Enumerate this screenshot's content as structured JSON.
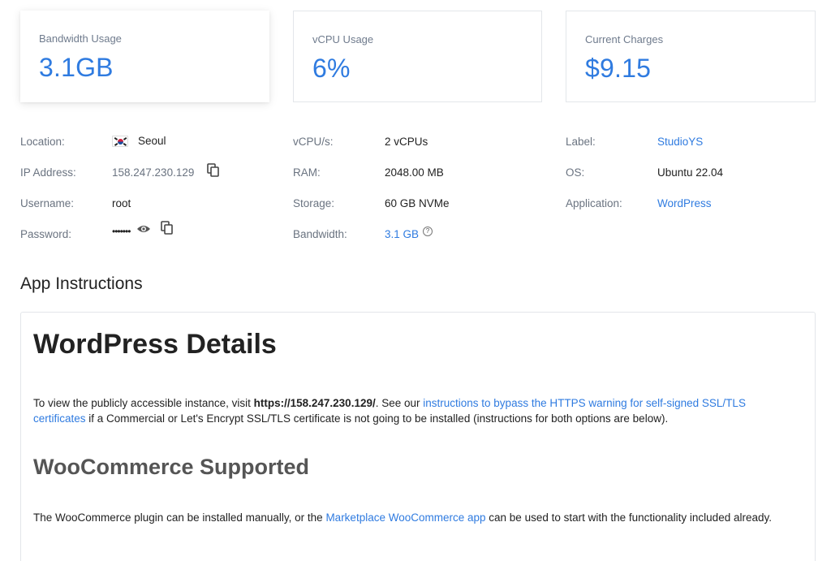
{
  "cards": [
    {
      "label": "Bandwidth Usage",
      "value": "3.1GB"
    },
    {
      "label": "vCPU Usage",
      "value": "6%"
    },
    {
      "label": "Current Charges",
      "value": "$9.15"
    }
  ],
  "details": {
    "location": {
      "key": "Location:",
      "value": "Seoul"
    },
    "ip": {
      "key": "IP Address:",
      "value": "158.247.230.129"
    },
    "username": {
      "key": "Username:",
      "value": "root"
    },
    "password": {
      "key": "Password:",
      "value": "•••••••"
    },
    "vcpu": {
      "key": "vCPU/s:",
      "value": "2 vCPUs"
    },
    "ram": {
      "key": "RAM:",
      "value": "2048.00 MB"
    },
    "storage": {
      "key": "Storage:",
      "value": "60 GB NVMe"
    },
    "bandwidth": {
      "key": "Bandwidth:",
      "value": "3.1 GB",
      "help": "?"
    },
    "label": {
      "key": "Label:",
      "value": "StudioYS"
    },
    "os": {
      "key": "OS:",
      "value": "Ubuntu 22.04"
    },
    "application": {
      "key": "Application:",
      "value": "WordPress"
    }
  },
  "instructions": {
    "section_title": "App Instructions",
    "wp_title": "WordPress Details",
    "p1_before": "To view the publicly accessible instance, visit ",
    "p1_url": "https://158.247.230.129/",
    "p1_mid": ". See our ",
    "p1_link": "instructions to bypass the HTTPS warning for self-signed SSL/TLS certificates",
    "p1_after": " if a Commercial or Let's Encrypt SSL/TLS certificate is not going to be installed (instructions for both options are below).",
    "woo_title": "WooCommerce Supported",
    "p2_before": "The WooCommerce plugin can be installed manually, or the ",
    "p2_link": "Marketplace WooCommerce app",
    "p2_after": " can be used to start with the functionality included already."
  },
  "colors": {
    "accent": "#2f7be0",
    "muted": "#6a7380"
  }
}
